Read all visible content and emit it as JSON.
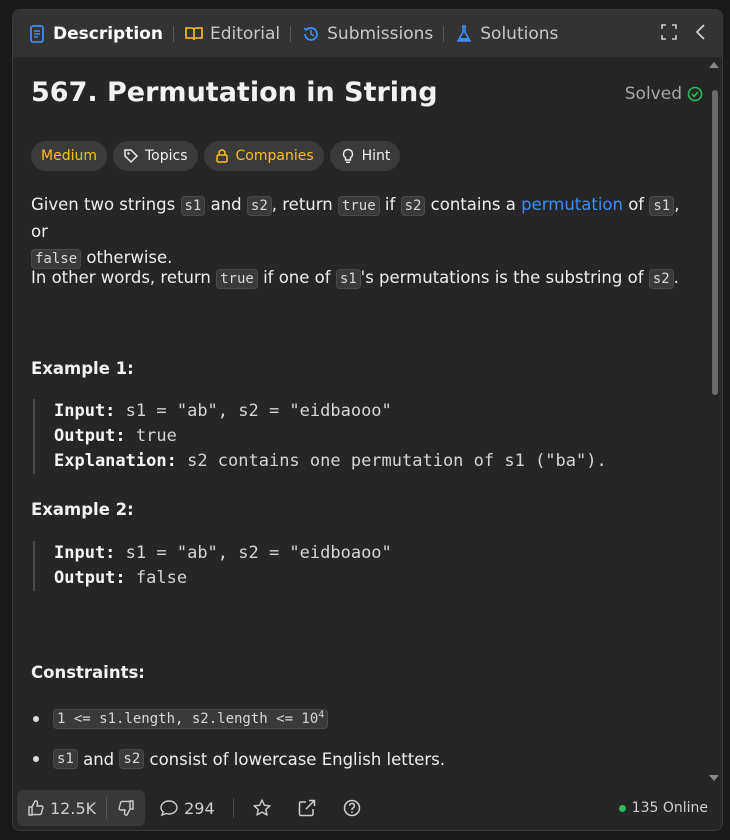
{
  "tabs": [
    {
      "label": "Description",
      "icon": "description-icon",
      "active": true
    },
    {
      "label": "Editorial",
      "icon": "book-icon"
    },
    {
      "label": "Submissions",
      "icon": "history-icon"
    },
    {
      "label": "Solutions",
      "icon": "flask-icon"
    }
  ],
  "problem": {
    "title": "567. Permutation in String",
    "status": "Solved",
    "chips": {
      "difficulty": "Medium",
      "topics": "Topics",
      "companies": "Companies",
      "hint": "Hint"
    },
    "desc": {
      "p1_a": "Given two strings ",
      "s1": "s1",
      "p1_b": " and ",
      "s2": "s2",
      "p1_c": ", return ",
      "true": "true",
      "p1_d": " if ",
      "p1_e": " contains a ",
      "link": "permutation",
      "p1_f": " of ",
      "p1_g": ", or",
      "false": "false",
      "p1_h": " otherwise.",
      "p2_a": "In other words, return ",
      "p2_b": " if one of ",
      "p2_c": "'s permutations is the substring of ",
      "p2_d": "."
    },
    "examples": [
      {
        "heading": "Example 1:",
        "input_label": "Input:",
        "input": "s1 = \"ab\", s2 = \"eidbaooo\"",
        "output_label": "Output:",
        "output": "true",
        "expl_label": "Explanation:",
        "expl": "s2 contains one permutation of s1 (\"ba\")."
      },
      {
        "heading": "Example 2:",
        "input_label": "Input:",
        "input": "s1 = \"ab\", s2 = \"eidboaoo\"",
        "output_label": "Output:",
        "output": "false"
      }
    ],
    "constraints": {
      "heading": "Constraints:",
      "c1_code": "1 <= s1.length, s2.length <= 10",
      "c1_sup": "4",
      "c2_a": "s1",
      "c2_b": " and ",
      "c2_c": "s2",
      "c2_d": " consist of lowercase English letters."
    }
  },
  "bottom": {
    "likes": "12.5K",
    "comments": "294",
    "online": "135 Online"
  },
  "colors": {
    "accent_blue": "#3b8cf5",
    "medium": "#ffc01e",
    "solved_green": "#2cbb5d",
    "online_green": "#2cbb5d"
  }
}
